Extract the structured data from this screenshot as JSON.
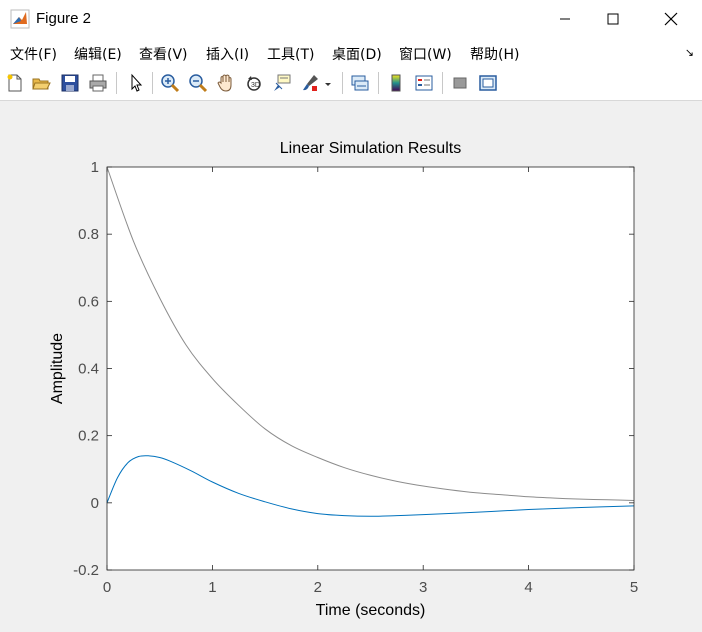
{
  "window": {
    "title": "Figure 2",
    "controls": {
      "minimize_icon": "minimize-icon",
      "maximize_icon": "maximize-icon",
      "close_icon": "close-icon"
    }
  },
  "menu": {
    "items": [
      {
        "label": "文件(F)"
      },
      {
        "label": "编辑(E)"
      },
      {
        "label": "查看(V)"
      },
      {
        "label": "插入(I)"
      },
      {
        "label": "工具(T)"
      },
      {
        "label": "桌面(D)"
      },
      {
        "label": "窗口(W)"
      },
      {
        "label": "帮助(H)"
      }
    ],
    "overflow_icon": "dock-arrow-icon"
  },
  "toolbar": {
    "buttons": [
      "new-figure-icon",
      "open-file-icon",
      "save-icon",
      "print-icon",
      "pointer-icon",
      "zoom-in-icon",
      "zoom-out-icon",
      "pan-icon",
      "rotate-3d-icon",
      "data-cursor-icon",
      "brush-icon",
      "brush-dropdown-icon",
      "link-plot-icon",
      "colorbar-icon",
      "legend-icon",
      "hide-plot-tools-icon",
      "show-plot-tools-icon"
    ]
  },
  "colors": {
    "series_blue": "#0072bd",
    "series_gray": "#8c8c8c",
    "axes_text": "#262626"
  },
  "chart_data": {
    "type": "line",
    "title": "Linear Simulation Results",
    "xlabel": "Time (seconds)",
    "ylabel": "Amplitude",
    "xlim": [
      0,
      5
    ],
    "ylim": [
      -0.2,
      1
    ],
    "xticks": [
      "0",
      "1",
      "2",
      "3",
      "4",
      "5"
    ],
    "yticks": [
      "-0.2",
      "0",
      "0.2",
      "0.4",
      "0.6",
      "0.8",
      "1"
    ],
    "grid": false,
    "series": [
      {
        "color": "#8c8c8c",
        "x": [
          0,
          0.25,
          0.5,
          0.75,
          1,
          1.25,
          1.5,
          1.75,
          2,
          2.25,
          2.5,
          2.75,
          3,
          3.25,
          3.5,
          3.75,
          4,
          4.25,
          4.5,
          4.75,
          5
        ],
        "y": [
          1,
          0.78,
          0.61,
          0.47,
          0.37,
          0.29,
          0.22,
          0.17,
          0.135,
          0.105,
          0.082,
          0.064,
          0.05,
          0.039,
          0.03,
          0.024,
          0.018,
          0.014,
          0.011,
          0.009,
          0.007
        ]
      },
      {
        "color": "#0072bd",
        "x": [
          0,
          0.1,
          0.2,
          0.3,
          0.4,
          0.5,
          0.6,
          0.8,
          1,
          1.25,
          1.5,
          1.75,
          2,
          2.25,
          2.5,
          2.75,
          3,
          3.5,
          4,
          4.5,
          5
        ],
        "y": [
          0,
          0.075,
          0.12,
          0.138,
          0.14,
          0.135,
          0.124,
          0.095,
          0.062,
          0.028,
          0.003,
          -0.018,
          -0.032,
          -0.038,
          -0.04,
          -0.038,
          -0.035,
          -0.028,
          -0.02,
          -0.014,
          -0.009
        ]
      }
    ]
  }
}
